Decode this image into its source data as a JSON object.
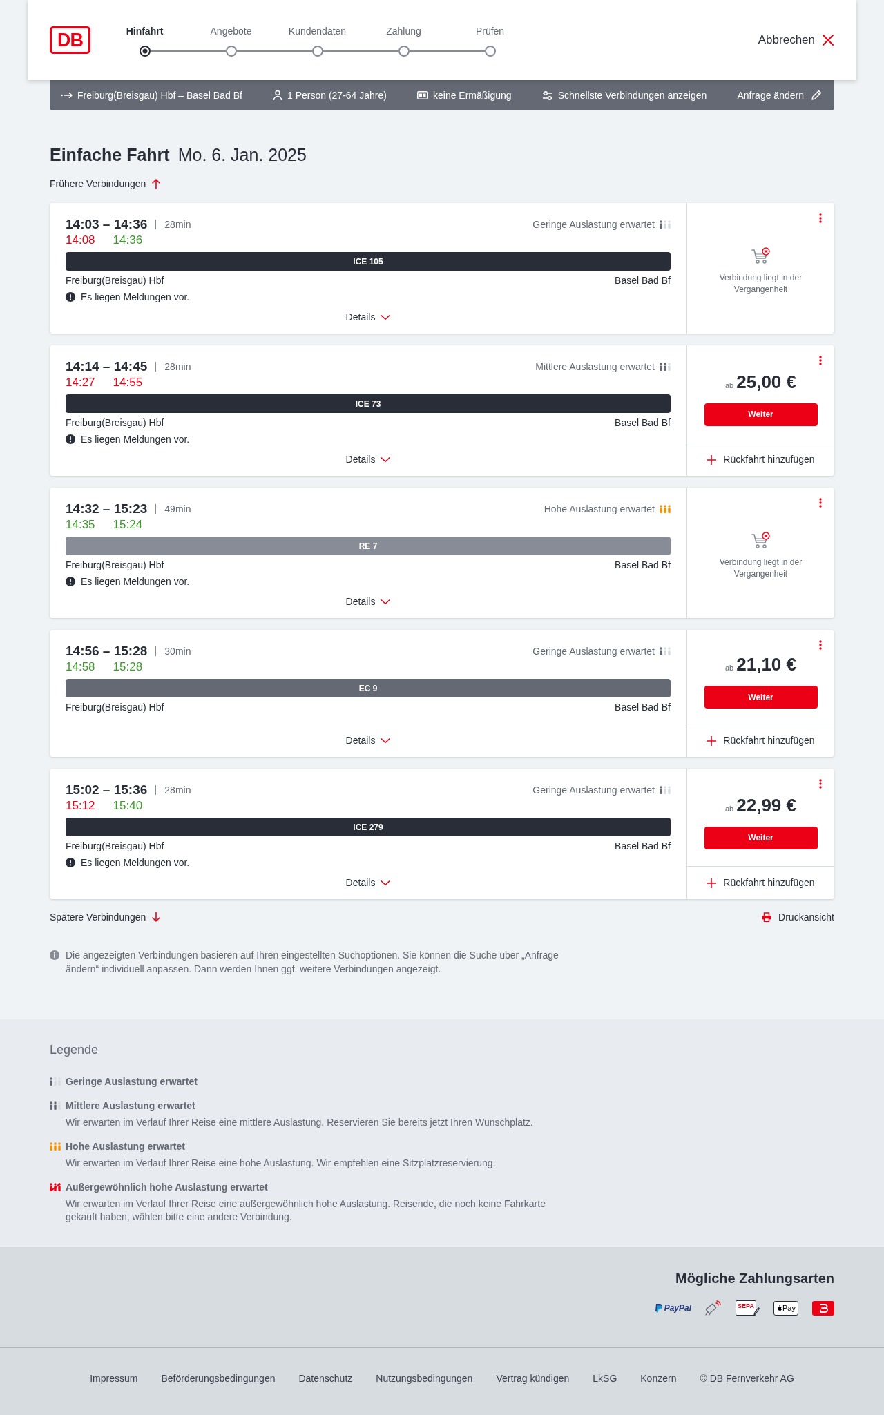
{
  "header": {
    "logo": "DB",
    "steps": [
      {
        "label": "Hinfahrt",
        "selected": true
      },
      {
        "label": "Angebote",
        "selected": false
      },
      {
        "label": "Kundendaten",
        "selected": false
      },
      {
        "label": "Zahlung",
        "selected": false
      },
      {
        "label": "Prüfen",
        "selected": false
      }
    ],
    "cancel_button": "Abbrechen"
  },
  "search_summary": {
    "route": "Freiburg(Breisgau) Hbf – Basel Bad Bf",
    "passengers": "1 Person (27-64 Jahre)",
    "discount": "keine Ermäßigung",
    "filter": "Schnellste Verbindungen anzeigen",
    "edit_button": "Anfrage ändern"
  },
  "heading": {
    "title": "Einfache Fahrt",
    "date": "Mo. 6. Jan. 2025"
  },
  "earlier_link": "Frühere Verbindungen",
  "connections": [
    {
      "times": "14:03 – 14:36",
      "duration": "28min",
      "realtime": [
        {
          "time": "14:08",
          "delayed": true
        },
        {
          "time": "14:36",
          "delayed": false
        }
      ],
      "occupancy": {
        "kind": "low",
        "label": "Geringe Auslastung erwartet"
      },
      "train": {
        "name": "ICE 105",
        "color": "#282d37"
      },
      "from": "Freiburg(Breisgau) Hbf",
      "to": "Basel Bad Bf",
      "message": "Es liegen Meldungen vor.",
      "details_button": "Details",
      "offer": {
        "kind": "past",
        "note": "Verbindung liegt in der Vergangenheit"
      }
    },
    {
      "times": "14:14 – 14:45",
      "duration": "28min",
      "realtime": [
        {
          "time": "14:27",
          "delayed": true
        },
        {
          "time": "14:55",
          "delayed": true
        }
      ],
      "occupancy": {
        "kind": "medium",
        "label": "Mittlere Auslastung erwartet"
      },
      "train": {
        "name": "ICE 73",
        "color": "#282d37"
      },
      "from": "Freiburg(Breisgau) Hbf",
      "to": "Basel Bad Bf",
      "message": "Es liegen Meldungen vor.",
      "details_button": "Details",
      "offer": {
        "kind": "price",
        "prefix": "ab",
        "price": "25,00 €",
        "button": "Weiter",
        "return_link": "Rückfahrt hinzufügen"
      }
    },
    {
      "times": "14:32 – 15:23",
      "duration": "49min",
      "realtime": [
        {
          "time": "14:35",
          "delayed": false
        },
        {
          "time": "15:24",
          "delayed": false
        }
      ],
      "occupancy": {
        "kind": "high",
        "label": "Hohe Auslastung erwartet"
      },
      "train": {
        "name": "RE 7",
        "color": "#878c96"
      },
      "from": "Freiburg(Breisgau) Hbf",
      "to": "Basel Bad Bf",
      "message": "Es liegen Meldungen vor.",
      "details_button": "Details",
      "offer": {
        "kind": "past",
        "note": "Verbindung liegt in der Vergangenheit"
      }
    },
    {
      "times": "14:56 – 15:28",
      "duration": "30min",
      "realtime": [
        {
          "time": "14:58",
          "delayed": false
        },
        {
          "time": "15:28",
          "delayed": false
        }
      ],
      "occupancy": {
        "kind": "low",
        "label": "Geringe Auslastung erwartet"
      },
      "train": {
        "name": "EC 9",
        "color": "#646973"
      },
      "from": "Freiburg(Breisgau) Hbf",
      "to": "Basel Bad Bf",
      "details_button": "Details",
      "offer": {
        "kind": "price",
        "prefix": "ab",
        "price": "21,10 €",
        "button": "Weiter",
        "return_link": "Rückfahrt hinzufügen"
      }
    },
    {
      "times": "15:02 – 15:36",
      "duration": "28min",
      "realtime": [
        {
          "time": "15:12",
          "delayed": true
        },
        {
          "time": "15:40",
          "delayed": false
        }
      ],
      "occupancy": {
        "kind": "low",
        "label": "Geringe Auslastung erwartet"
      },
      "train": {
        "name": "ICE 279",
        "color": "#282d37"
      },
      "from": "Freiburg(Breisgau) Hbf",
      "to": "Basel Bad Bf",
      "message": "Es liegen Meldungen vor.",
      "details_button": "Details",
      "offer": {
        "kind": "price",
        "prefix": "ab",
        "price": "22,99 €",
        "button": "Weiter",
        "return_link": "Rückfahrt hinzufügen"
      }
    }
  ],
  "later_link": "Spätere Verbindungen",
  "print_link": "Druckansicht",
  "info_note": "Die angezeigten Verbindungen basieren auf Ihren eingestellten Suchoptionen. Sie können die Suche über „Anfrage ändern“ individuell anpassen. Dann werden Ihnen ggf. weitere Verbindungen angezeigt.",
  "legend": {
    "title": "Legende",
    "items": [
      {
        "kind": "low",
        "label": "Geringe Auslastung erwartet"
      },
      {
        "kind": "medium",
        "label": "Mittlere Auslastung erwartet",
        "description": "Wir erwarten im Verlauf Ihrer Reise eine mittlere Auslastung. Reservieren Sie bereits jetzt Ihren Wunschplatz."
      },
      {
        "kind": "high",
        "label": "Hohe Auslastung erwartet",
        "description": "Wir erwarten im Verlauf Ihrer Reise eine hohe Auslastung. Wir empfehlen eine Sitzplatzreservierung."
      },
      {
        "kind": "very_high",
        "label": "Außergewöhnlich hohe Auslastung erwartet",
        "description": "Wir erwarten im Verlauf Ihrer Reise eine außergewöhnlich hohe Auslastung. Reisende, die noch keine Fahrkarte gekauft haben, wählen bitte eine andere Verbindung."
      }
    ]
  },
  "payment": {
    "title": "Mögliche Zahlungsarten",
    "methods": [
      {
        "kind": "paypal",
        "label": "PayPal"
      },
      {
        "kind": "contactless_card"
      },
      {
        "kind": "sepa",
        "label": "SEPA"
      },
      {
        "kind": "apple_pay",
        "label": "Pay"
      },
      {
        "kind": "db_tile"
      }
    ]
  },
  "footer": {
    "links": [
      "Impressum",
      "Beförderungsbedingungen",
      "Datenschutz",
      "Nutzungsbedingungen",
      "Vertrag kündigen",
      "LkSG",
      "Konzern"
    ],
    "copyright": "© DB Fernverkehr AG"
  }
}
